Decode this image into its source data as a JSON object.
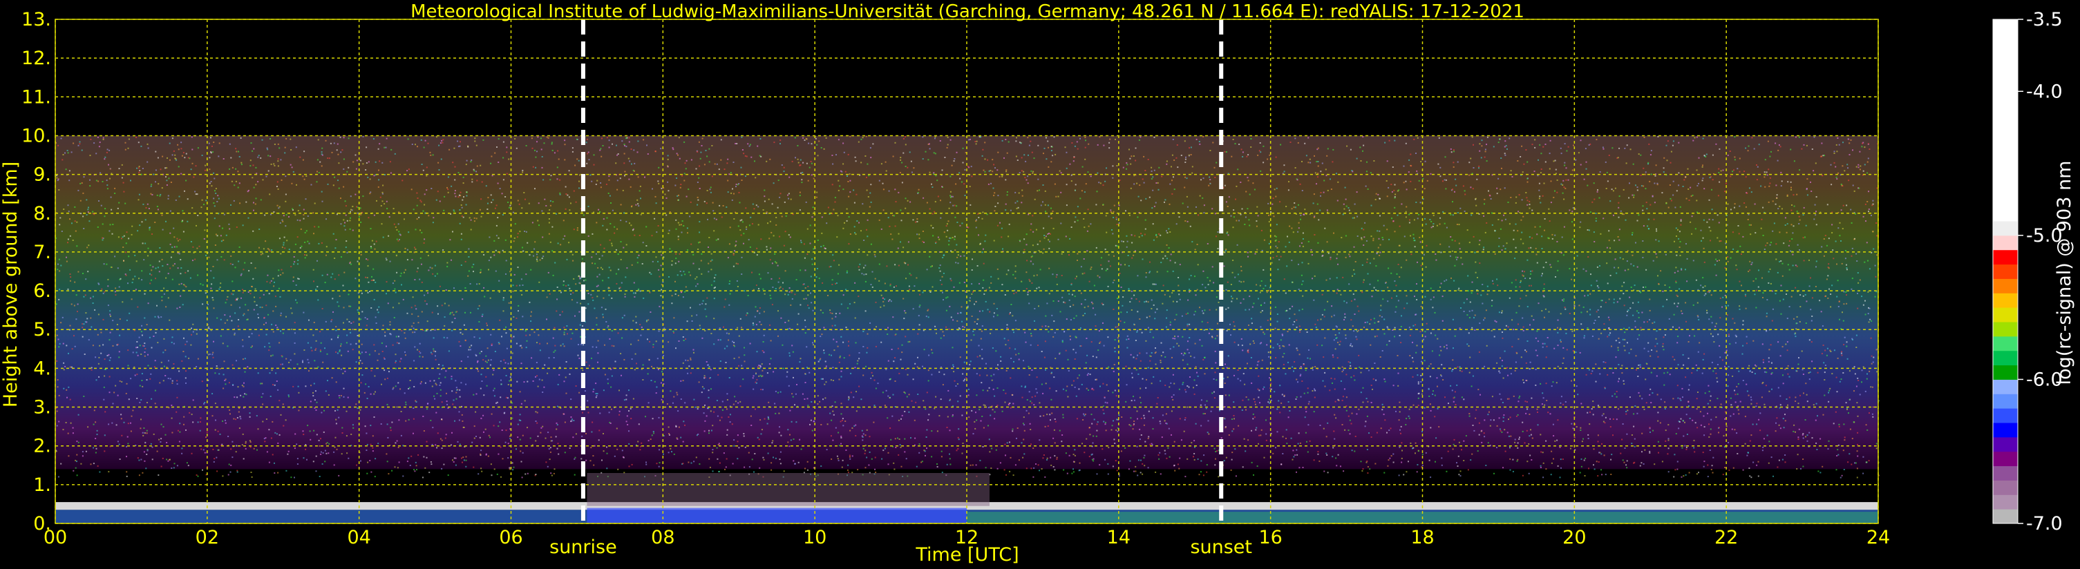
{
  "chart_data": {
    "type": "heatmap",
    "title": "Meteorological Institute of Ludwig-Maximilians-Universität (Garching, Germany; 48.261 N / 11.664 E):    redYALIS: 17-12-2021",
    "xlabel": "Time [UTC]",
    "ylabel": "Height above ground [km]",
    "xlim": [
      0,
      24
    ],
    "ylim": [
      0,
      13
    ],
    "x_ticks": [
      "00",
      "02",
      "04",
      "06",
      "08",
      "10",
      "12",
      "14",
      "16",
      "18",
      "20",
      "22",
      "24"
    ],
    "y_ticks": [
      "0.",
      "1.",
      "2.",
      "3.",
      "4.",
      "5.",
      "6.",
      "7.",
      "8.",
      "9.",
      "10.",
      "11.",
      "12.",
      "13."
    ],
    "grid": true,
    "data_top_km": 10,
    "events": [
      {
        "label": "sunrise",
        "x": 6.95
      },
      {
        "label": "sunset",
        "x": 15.35
      }
    ],
    "colorbar": {
      "label": "log(rc-signal) @ 903 nm",
      "range": [
        -7.0,
        -3.5
      ],
      "tick_labels": [
        "-3.5",
        "-4.0",
        "-5.0",
        "-6.0",
        "-7.0"
      ],
      "tick_values": [
        -3.5,
        -4.0,
        -5.0,
        -6.0,
        -7.0
      ],
      "colors": [
        "#b8b8b8",
        "#b090b0",
        "#a070a0",
        "#90509a",
        "#800080",
        "#5a00b4",
        "#0000ff",
        "#3050ff",
        "#6090ff",
        "#90b0ff",
        "#00a000",
        "#00c050",
        "#40e070",
        "#a0e000",
        "#e0e000",
        "#ffc000",
        "#ff8000",
        "#ff4000",
        "#ff0000",
        "#ffd0d0",
        "#eeeeee",
        "#ffffff"
      ]
    },
    "colors": {
      "axis_text": "#ffff00",
      "grid": "#d8d800",
      "background": "#000000",
      "event_line": "#ffffff"
    }
  }
}
